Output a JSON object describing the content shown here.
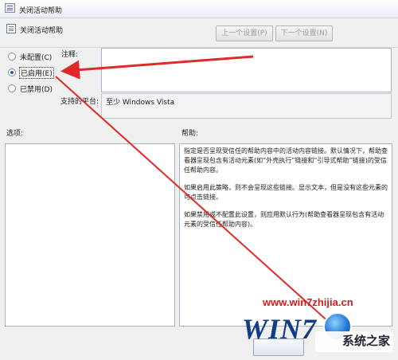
{
  "window": {
    "title": "关闭活动帮助"
  },
  "header": {
    "policy_name": "关闭活动帮助",
    "prev_setting": "上一个设置(P)",
    "next_setting": "下一个设置(N)"
  },
  "state": {
    "options": [
      {
        "label": "未配置(C)",
        "selected": false
      },
      {
        "label": "已启用(E)",
        "selected": true
      },
      {
        "label": "已禁用(D)",
        "selected": false
      }
    ]
  },
  "comment": {
    "label": "注释:",
    "value": ""
  },
  "supported": {
    "label": "支持的平台:",
    "value": "至少 Windows Vista"
  },
  "options_panel": {
    "label": "选项:"
  },
  "help_panel": {
    "label": "帮助:",
    "paragraphs": [
      "指定是否呈现受信任的帮助内容中的活动内容链接。默认情况下，帮助查看器呈现包含有活动元素(如“外壳执行”链接和“引导式帮助”链接)的受信任帮助内容。",
      "如果启用此策略，则不会呈现这些链接。显示文本，但是没有这些元素的可点击链接。",
      "如果禁用或不配置此设置，则应用默认行为(帮助查看器呈现包含有活动元素的受信任帮助内容)。"
    ]
  },
  "annotation": {
    "arrow_color": "#e02a2a"
  },
  "watermark": {
    "url": "www.win7zhijia.cn",
    "wordmark": "WIN7",
    "site_name": "系统之家"
  }
}
